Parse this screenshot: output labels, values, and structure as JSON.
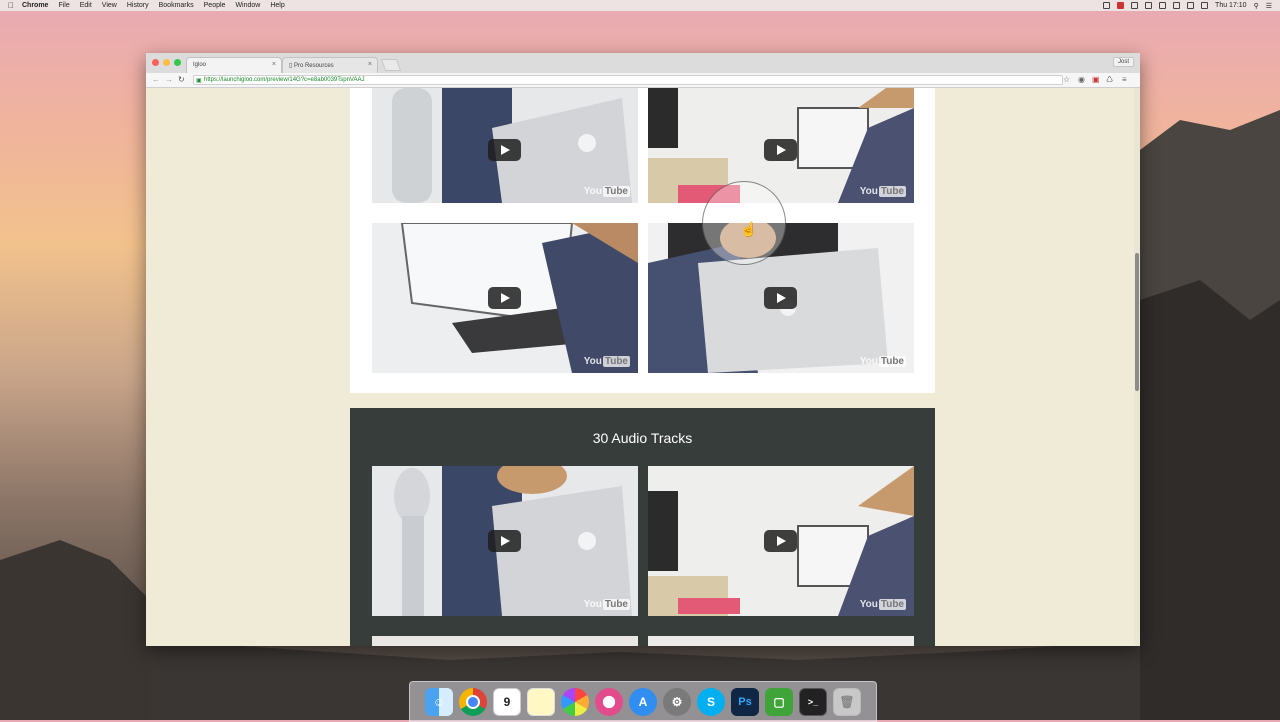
{
  "menubar": {
    "app": "Chrome",
    "items": [
      "File",
      "Edit",
      "View",
      "History",
      "Bookmarks",
      "People",
      "Window",
      "Help"
    ],
    "clock": "Thu 17:10"
  },
  "browser": {
    "tabs": [
      {
        "label": "Igloo"
      },
      {
        "label": "Pro Resources"
      }
    ],
    "profile": "Jost",
    "url": "https://launchigloo.com/preview/14G?c=e8ab0039TspnVAAJ"
  },
  "page": {
    "section_title": "30 Audio Tracks",
    "youtube_label": "You",
    "youtube_tube": "Tube"
  },
  "dock": {
    "icons": [
      "finder-icon",
      "chrome-icon",
      "calendar-icon",
      "notes-icon",
      "photos-icon",
      "itunes-icon",
      "app-store-icon",
      "system-preferences-icon",
      "skype-icon",
      "photoshop-icon",
      "camtasia-icon",
      "terminal-icon",
      "trash-icon"
    ],
    "calendar_day": "9",
    "skype_letter": "S",
    "photoshop_label": "Ps"
  },
  "colors": {
    "page_bg": "#efebd6",
    "dark_section": "#373d3a",
    "url_text": "#1a8a2a"
  }
}
